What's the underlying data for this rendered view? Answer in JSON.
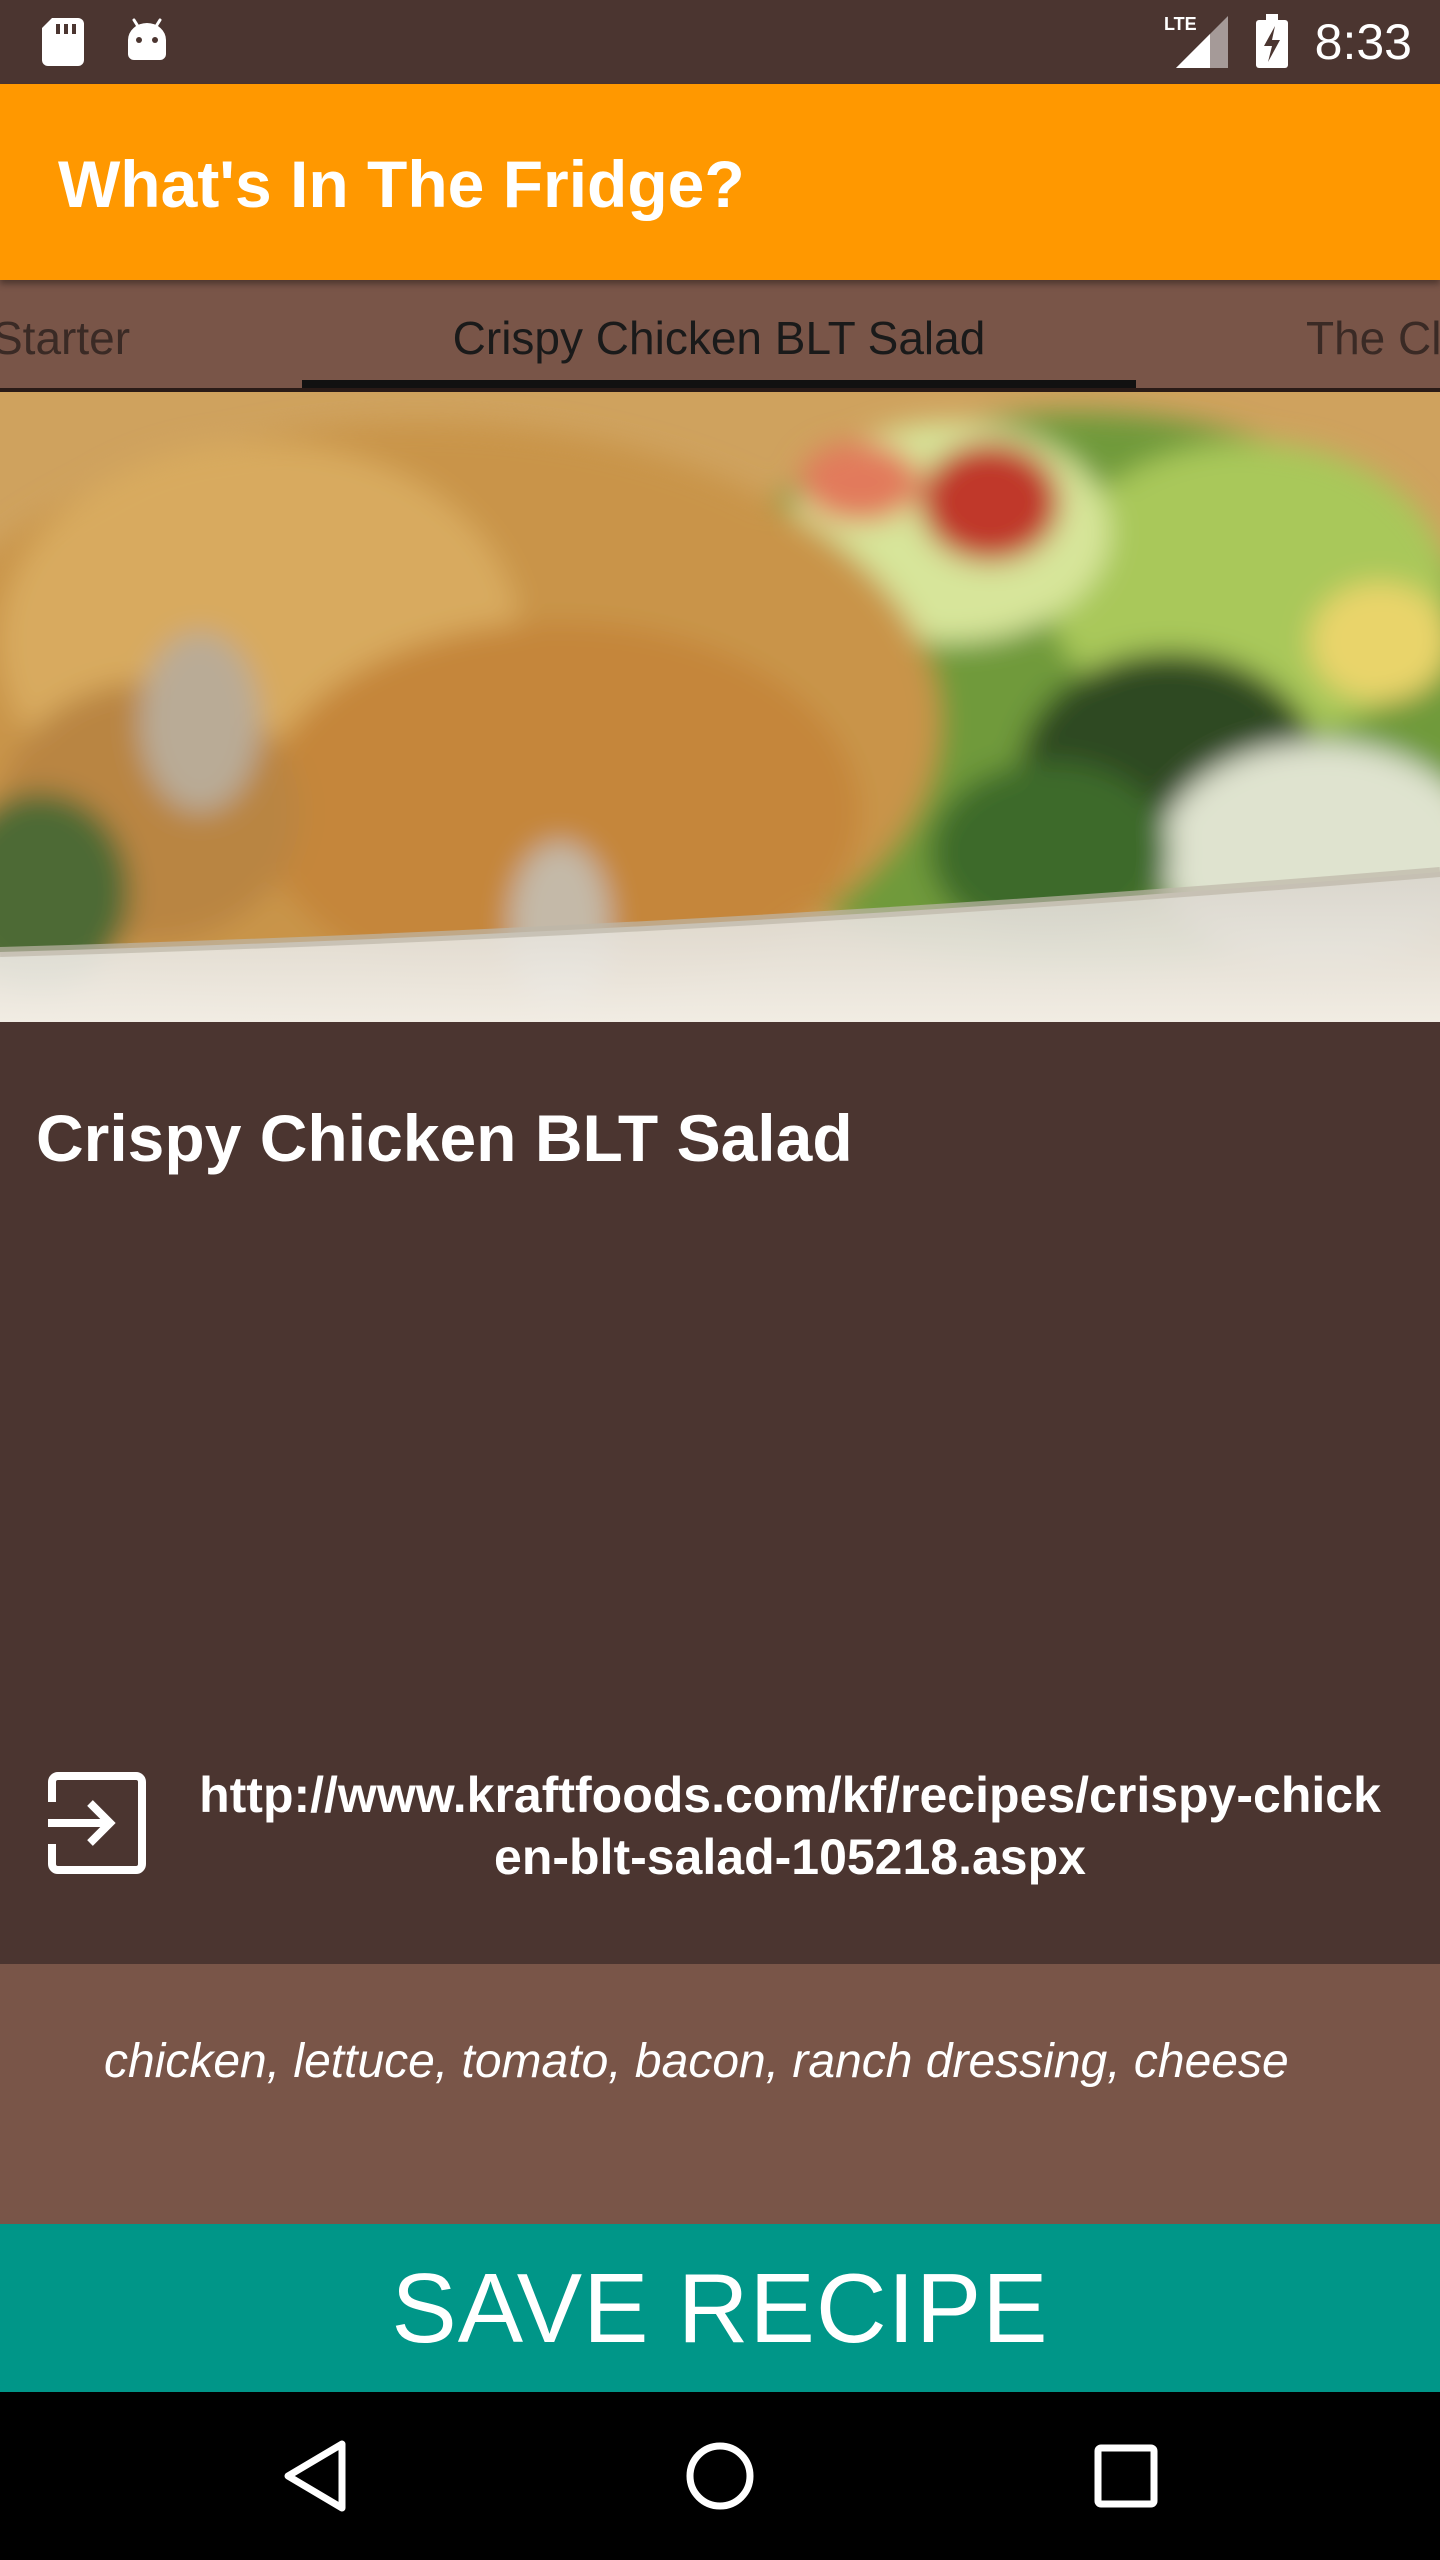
{
  "status_bar": {
    "time": "8:33",
    "network_label": "LTE",
    "icons": [
      "sd-card-icon",
      "android-debug-icon",
      "lte-signal-icon",
      "battery-charging-icon"
    ]
  },
  "app_bar": {
    "title": "What's In The Fridge?"
  },
  "tabs": [
    {
      "label": "Starter",
      "state": "previous"
    },
    {
      "label": "Crispy Chicken BLT Salad",
      "state": "selected"
    },
    {
      "label": "The Cl",
      "state": "next"
    }
  ],
  "recipe": {
    "title": "Crispy Chicken BLT Salad",
    "url": "http://www.kraftfoods.com/kf/recipes/crispy-chicken-blt-salad-105218.aspx",
    "ingredients": "chicken, lettuce, tomato, bacon, ranch dressing, cheese"
  },
  "actions": {
    "save_label": "SAVE RECIPE"
  },
  "nav_bar": {
    "icons": [
      "back-icon",
      "home-icon",
      "recents-icon"
    ]
  },
  "colors": {
    "primary": "#ff9800",
    "background": "#4b3530",
    "surface": "#795548",
    "accent": "#009688"
  }
}
